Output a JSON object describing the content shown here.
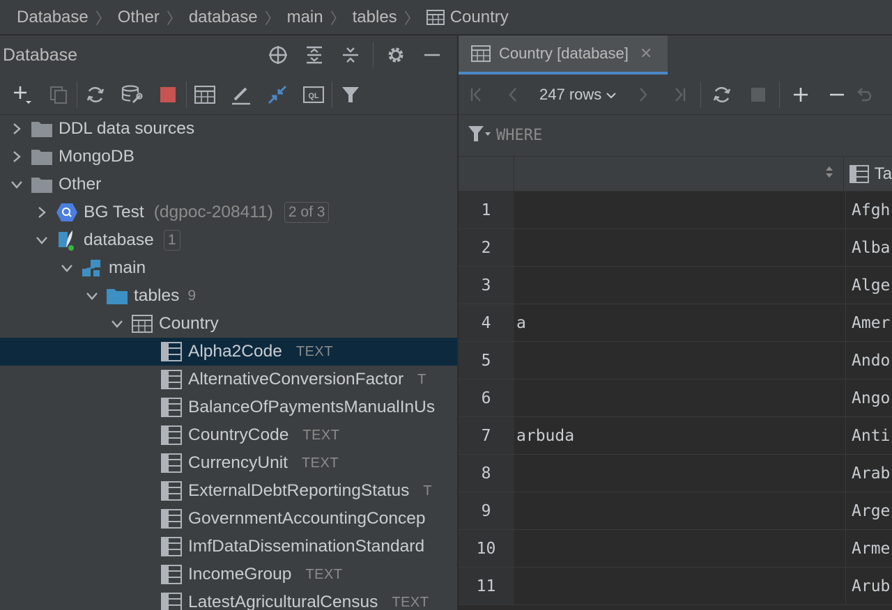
{
  "breadcrumb": [
    "Database",
    "Other",
    "database",
    "main",
    "tables",
    "Country"
  ],
  "panel": {
    "title": "Database"
  },
  "tree": {
    "ddl": "DDL data sources",
    "mongo": "MongoDB",
    "other": "Other",
    "bg_test": {
      "label": "BG Test",
      "detail": "(dgpoc-208411)",
      "badge": "2 of 3"
    },
    "database": {
      "label": "database",
      "badge": "1"
    },
    "main": "main",
    "tables": {
      "label": "tables",
      "count": "9"
    },
    "country": "Country",
    "columns": [
      {
        "name": "Alpha2Code",
        "type": "TEXT"
      },
      {
        "name": "AlternativeConversionFactor",
        "type": "T"
      },
      {
        "name": "BalanceOfPaymentsManualInUs",
        "type": ""
      },
      {
        "name": "CountryCode",
        "type": "TEXT"
      },
      {
        "name": "CurrencyUnit",
        "type": "TEXT"
      },
      {
        "name": "ExternalDebtReportingStatus",
        "type": "T"
      },
      {
        "name": "GovernmentAccountingConcep",
        "type": ""
      },
      {
        "name": "ImfDataDisseminationStandard",
        "type": ""
      },
      {
        "name": "IncomeGroup",
        "type": "TEXT"
      },
      {
        "name": "LatestAgriculturalCensus",
        "type": "TEXT"
      }
    ]
  },
  "editor": {
    "tab_label": "Country [database]",
    "rows_label": "247 rows",
    "filter_placeholder": "WHERE",
    "col2_header": "Ta",
    "rows": [
      {
        "n": "1",
        "c1": "",
        "c2": "Afgh"
      },
      {
        "n": "2",
        "c1": "",
        "c2": "Alba"
      },
      {
        "n": "3",
        "c1": "",
        "c2": "Alge"
      },
      {
        "n": "4",
        "c1": "a",
        "c2": "Amer"
      },
      {
        "n": "5",
        "c1": "",
        "c2": "Ando"
      },
      {
        "n": "6",
        "c1": "",
        "c2": "Ango"
      },
      {
        "n": "7",
        "c1": "arbuda",
        "c2": "Anti"
      },
      {
        "n": "8",
        "c1": "",
        "c2": "Arab"
      },
      {
        "n": "9",
        "c1": "",
        "c2": "Arge"
      },
      {
        "n": "10",
        "c1": "",
        "c2": "Arme"
      },
      {
        "n": "11",
        "c1": "",
        "c2": "Arub"
      }
    ]
  },
  "colors": {
    "panel_bg": "#3c3f41",
    "grid_bg": "#2b2b2b",
    "selection": "#0d293e",
    "accent": "#4a88c7",
    "stop_red": "#c75450",
    "folder": "#8a9096",
    "tables_folder": "#3d8fc4"
  }
}
